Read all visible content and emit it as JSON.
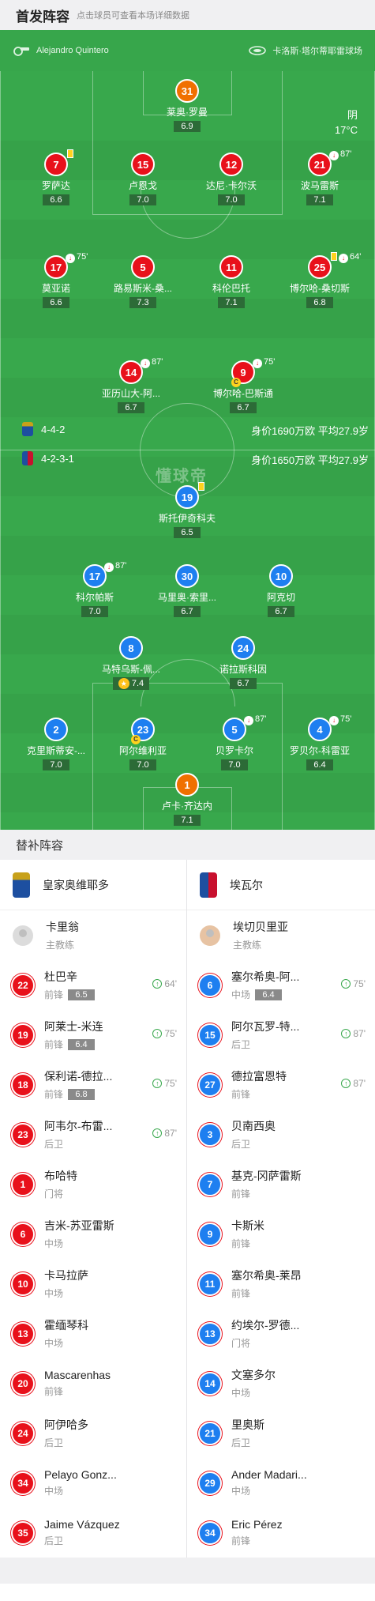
{
  "header": {
    "title": "首发阵容",
    "subtitle": "点击球员可查看本场详细数据"
  },
  "pitch_info": {
    "referee": "Alejandro Quintero",
    "venue": "卡洛斯·塔尔蒂耶雷球场",
    "weather": "阴",
    "temperature": "17°C",
    "watermark": "懂球帝"
  },
  "formations": {
    "home": {
      "formation": "4-4-2",
      "value": "身价1690万欧 平均27.9岁"
    },
    "away": {
      "formation": "4-2-3-1",
      "value": "身价1650万欧 平均27.9岁"
    }
  },
  "home_players": [
    {
      "num": "31",
      "name": "莱奥·罗曼",
      "rating": "6.9",
      "gk": true
    },
    {
      "num": "7",
      "name": "罗萨达",
      "rating": "6.6",
      "yellow": true
    },
    {
      "num": "15",
      "name": "卢恩戈",
      "rating": "7.0"
    },
    {
      "num": "12",
      "name": "达尼·卡尔沃",
      "rating": "7.0"
    },
    {
      "num": "21",
      "name": "波马雷斯",
      "rating": "7.1",
      "sub_out": "87'"
    },
    {
      "num": "17",
      "name": "莫亚诺",
      "rating": "6.6",
      "sub_out": "75'"
    },
    {
      "num": "5",
      "name": "路易斯米-桑...",
      "rating": "7.3"
    },
    {
      "num": "11",
      "name": "科伦巴托",
      "rating": "7.1"
    },
    {
      "num": "25",
      "name": "博尔哈-桑切斯",
      "rating": "6.8",
      "yellow": true,
      "sub_out": "64'"
    },
    {
      "num": "14",
      "name": "亚历山大-阿...",
      "rating": "6.7",
      "sub_out": "87'"
    },
    {
      "num": "9",
      "name": "博尔哈-巴斯通",
      "rating": "6.7",
      "sub_out": "75'",
      "captain": true
    }
  ],
  "away_players": [
    {
      "num": "19",
      "name": "斯托伊奇科夫",
      "rating": "6.5",
      "yellow": true
    },
    {
      "num": "17",
      "name": "科尔帕斯",
      "rating": "7.0",
      "sub_out": "87'"
    },
    {
      "num": "30",
      "name": "马里奥·索里...",
      "rating": "6.7"
    },
    {
      "num": "10",
      "name": "阿克切",
      "rating": "6.7"
    },
    {
      "num": "8",
      "name": "马特乌斯-佩...",
      "rating": "7.4",
      "best": true
    },
    {
      "num": "24",
      "name": "诺拉斯科因",
      "rating": "6.7"
    },
    {
      "num": "2",
      "name": "克里斯蒂安-...",
      "rating": "7.0"
    },
    {
      "num": "23",
      "name": "阿尔维利亚",
      "rating": "7.0",
      "captain": true
    },
    {
      "num": "5",
      "name": "贝罗卡尔",
      "rating": "7.0",
      "sub_out": "87'"
    },
    {
      "num": "4",
      "name": "罗贝尔-科雷亚",
      "rating": "6.4",
      "sub_out": "75'"
    },
    {
      "num": "1",
      "name": "卢卡·齐达内",
      "rating": "7.1",
      "gk": true
    }
  ],
  "captain_mark": "C",
  "subs_header": "替补阵容",
  "teams": {
    "home": "皇家奥维耶多",
    "away": "埃瓦尔"
  },
  "coaches": {
    "home": {
      "name": "卡里翁",
      "role": "主教练"
    },
    "away": {
      "name": "埃切贝里亚",
      "role": "主教练"
    }
  },
  "home_subs": [
    {
      "num": "22",
      "name": "杜巴辛",
      "pos": "前锋",
      "rating": "6.5",
      "in": "64'"
    },
    {
      "num": "19",
      "name": "阿莱士-米连",
      "pos": "前锋",
      "rating": "6.4",
      "in": "75'"
    },
    {
      "num": "18",
      "name": "保利诺-德拉...",
      "pos": "前锋",
      "rating": "6.8",
      "in": "75'"
    },
    {
      "num": "23",
      "name": "阿韦尔-布雷...",
      "pos": "后卫",
      "in": "87'"
    },
    {
      "num": "1",
      "name": "布哈特",
      "pos": "门将"
    },
    {
      "num": "6",
      "name": "吉米-苏亚雷斯",
      "pos": "中场"
    },
    {
      "num": "10",
      "name": "卡马拉萨",
      "pos": "中场"
    },
    {
      "num": "13",
      "name": "霍缅琴科",
      "pos": "中场"
    },
    {
      "num": "20",
      "name": "Mascarenhas",
      "pos": "前锋"
    },
    {
      "num": "24",
      "name": "阿伊哈多",
      "pos": "后卫"
    },
    {
      "num": "34",
      "name": "Pelayo Gonz...",
      "pos": "中场"
    },
    {
      "num": "35",
      "name": "Jaime Vázquez",
      "pos": "后卫"
    }
  ],
  "away_subs": [
    {
      "num": "6",
      "name": "塞尔希奥-阿...",
      "pos": "中场",
      "rating": "6.4",
      "in": "75'"
    },
    {
      "num": "15",
      "name": "阿尔瓦罗-特...",
      "pos": "后卫",
      "in": "87'"
    },
    {
      "num": "27",
      "name": "德拉富恩特",
      "pos": "前锋",
      "in": "87'"
    },
    {
      "num": "3",
      "name": "贝南西奥",
      "pos": "后卫"
    },
    {
      "num": "7",
      "name": "基克-冈萨雷斯",
      "pos": "前锋"
    },
    {
      "num": "9",
      "name": "卡斯米",
      "pos": "前锋"
    },
    {
      "num": "11",
      "name": "塞尔希奥-莱昂",
      "pos": "前锋"
    },
    {
      "num": "13",
      "name": "约埃尔-罗德...",
      "pos": "门将"
    },
    {
      "num": "14",
      "name": "文塞多尔",
      "pos": "中场"
    },
    {
      "num": "21",
      "name": "里奥斯",
      "pos": "后卫"
    },
    {
      "num": "29",
      "name": "Ander Madari...",
      "pos": "中场"
    },
    {
      "num": "34",
      "name": "Eric Pérez",
      "pos": "前锋"
    }
  ]
}
